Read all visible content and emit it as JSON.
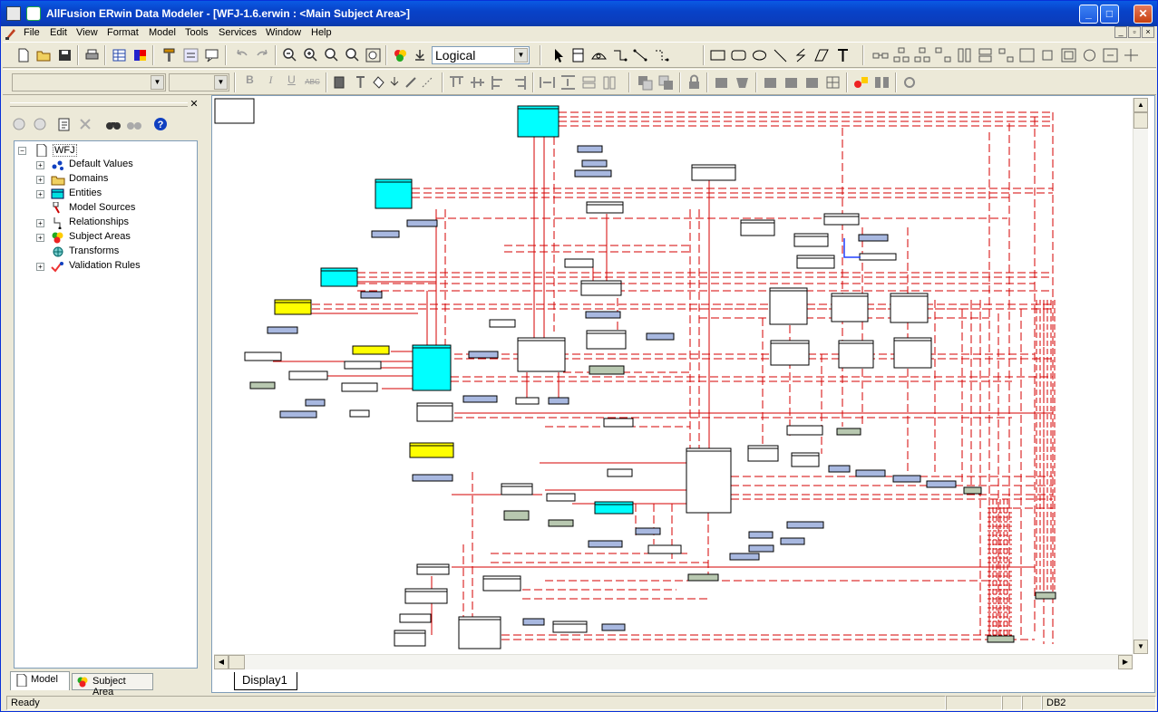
{
  "window": {
    "title": "AllFusion ERwin Data Modeler - [WFJ-1.6.erwin : <Main Subject Area>]"
  },
  "menu": {
    "items": [
      "File",
      "Edit",
      "View",
      "Format",
      "Model",
      "Tools",
      "Services",
      "Window",
      "Help"
    ]
  },
  "toolbar": {
    "view_mode": "Logical",
    "font_combo": "",
    "size_combo": ""
  },
  "model_explorer": {
    "root": "WFJ",
    "items": [
      {
        "label": "Default Values",
        "icon": "default-values-icon"
      },
      {
        "label": "Domains",
        "icon": "domains-icon"
      },
      {
        "label": "Entities",
        "icon": "entities-icon"
      },
      {
        "label": "Model Sources",
        "icon": "model-sources-icon"
      },
      {
        "label": "Relationships",
        "icon": "relationships-icon"
      },
      {
        "label": "Subject Areas",
        "icon": "subject-areas-icon"
      },
      {
        "label": "Transforms",
        "icon": "transforms-icon"
      },
      {
        "label": "Validation Rules",
        "icon": "validation-rules-icon"
      }
    ],
    "tabs": [
      "Model",
      "Subject Area"
    ]
  },
  "diagram": {
    "tab": "Display1",
    "colors": {
      "relationship": "#d40000",
      "entity_border": "#000000",
      "cyan_entity": "#00ffff",
      "yellow_entity": "#ffff00",
      "blue_entity": "#a8b8e0",
      "gray_entity": "#b8c8b0"
    }
  },
  "status": {
    "text": "Ready",
    "db": "DB2"
  }
}
